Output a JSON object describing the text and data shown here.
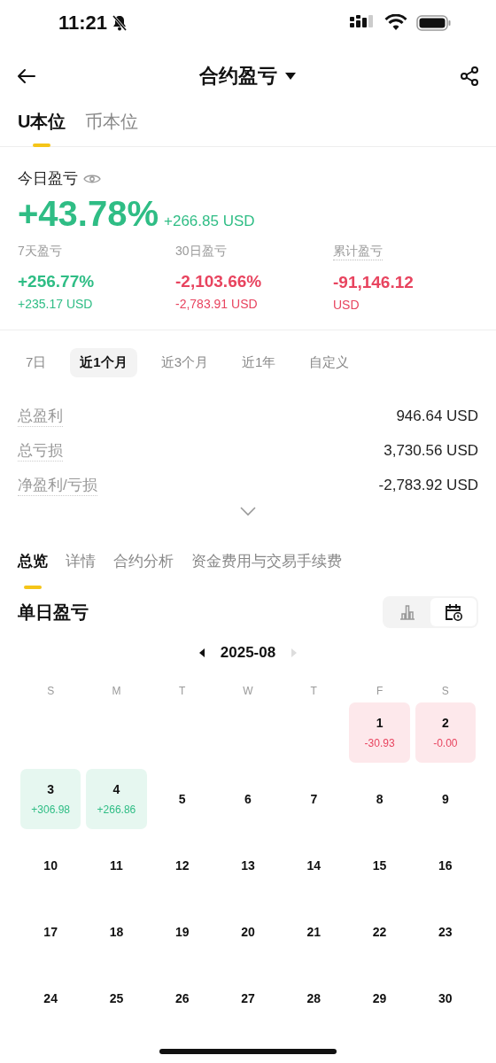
{
  "status_bar": {
    "time": "11:21"
  },
  "header": {
    "title": "合约盈亏"
  },
  "tabs": [
    {
      "label": "U本位",
      "selected": true
    },
    {
      "label": "币本位",
      "selected": false
    }
  ],
  "today": {
    "label": "今日盈亏",
    "percent": "+43.78%",
    "amount": "+266.85 USD",
    "kind": "gain"
  },
  "stats": [
    {
      "label": "7天盈亏",
      "value": "+256.77%",
      "sub": "+235.17 USD",
      "kind": "gain",
      "dotted": false
    },
    {
      "label": "30日盈亏",
      "value": "-2,103.66%",
      "sub": "-2,783.91 USD",
      "kind": "loss",
      "dotted": false
    },
    {
      "label": "累计盈亏",
      "value": "-91,146.12",
      "sub": "USD",
      "kind": "loss",
      "dotted": true
    }
  ],
  "periods": [
    {
      "label": "7日",
      "selected": false
    },
    {
      "label": "近1个月",
      "selected": true
    },
    {
      "label": "近3个月",
      "selected": false
    },
    {
      "label": "近1年",
      "selected": false
    },
    {
      "label": "自定义",
      "selected": false
    }
  ],
  "summary": [
    {
      "label": "总盈利",
      "value": "946.64 USD"
    },
    {
      "label": "总亏损",
      "value": "3,730.56 USD"
    },
    {
      "label": "净盈利/亏损",
      "value": "-2,783.92 USD"
    }
  ],
  "section_tabs": [
    {
      "label": "总览",
      "selected": true
    },
    {
      "label": "详情",
      "selected": false
    },
    {
      "label": "合约分析",
      "selected": false
    },
    {
      "label": "资金费用与交易手续费",
      "selected": false
    }
  ],
  "daily": {
    "title": "单日盈亏",
    "views": [
      {
        "kind": "bars",
        "selected": false
      },
      {
        "kind": "calendar",
        "selected": true
      }
    ],
    "month": "2025-08",
    "next_disabled": true,
    "weekdays": [
      "S",
      "M",
      "T",
      "W",
      "T",
      "F",
      "S"
    ],
    "days": [
      {
        "kind": "blank"
      },
      {
        "kind": "blank"
      },
      {
        "kind": "blank"
      },
      {
        "kind": "blank"
      },
      {
        "kind": "blank"
      },
      {
        "kind": "loss",
        "day": "1",
        "pnl": "-30.93"
      },
      {
        "kind": "loss",
        "day": "2",
        "pnl": "-0.00"
      },
      {
        "kind": "gain",
        "day": "3",
        "pnl": "+306.98"
      },
      {
        "kind": "gain",
        "day": "4",
        "pnl": "+266.86"
      },
      {
        "kind": "plain",
        "day": "5"
      },
      {
        "kind": "plain",
        "day": "6"
      },
      {
        "kind": "plain",
        "day": "7"
      },
      {
        "kind": "plain",
        "day": "8"
      },
      {
        "kind": "plain",
        "day": "9"
      },
      {
        "kind": "plain",
        "day": "10"
      },
      {
        "kind": "plain",
        "day": "11"
      },
      {
        "kind": "plain",
        "day": "12"
      },
      {
        "kind": "plain",
        "day": "13"
      },
      {
        "kind": "plain",
        "day": "14"
      },
      {
        "kind": "plain",
        "day": "15"
      },
      {
        "kind": "plain",
        "day": "16"
      },
      {
        "kind": "plain",
        "day": "17"
      },
      {
        "kind": "plain",
        "day": "18"
      },
      {
        "kind": "plain",
        "day": "19"
      },
      {
        "kind": "plain",
        "day": "20"
      },
      {
        "kind": "plain",
        "day": "21"
      },
      {
        "kind": "plain",
        "day": "22"
      },
      {
        "kind": "plain",
        "day": "23"
      },
      {
        "kind": "plain",
        "day": "24"
      },
      {
        "kind": "plain",
        "day": "25"
      },
      {
        "kind": "plain",
        "day": "26"
      },
      {
        "kind": "plain",
        "day": "27"
      },
      {
        "kind": "plain",
        "day": "28"
      },
      {
        "kind": "plain",
        "day": "29"
      },
      {
        "kind": "plain",
        "day": "30"
      }
    ]
  }
}
